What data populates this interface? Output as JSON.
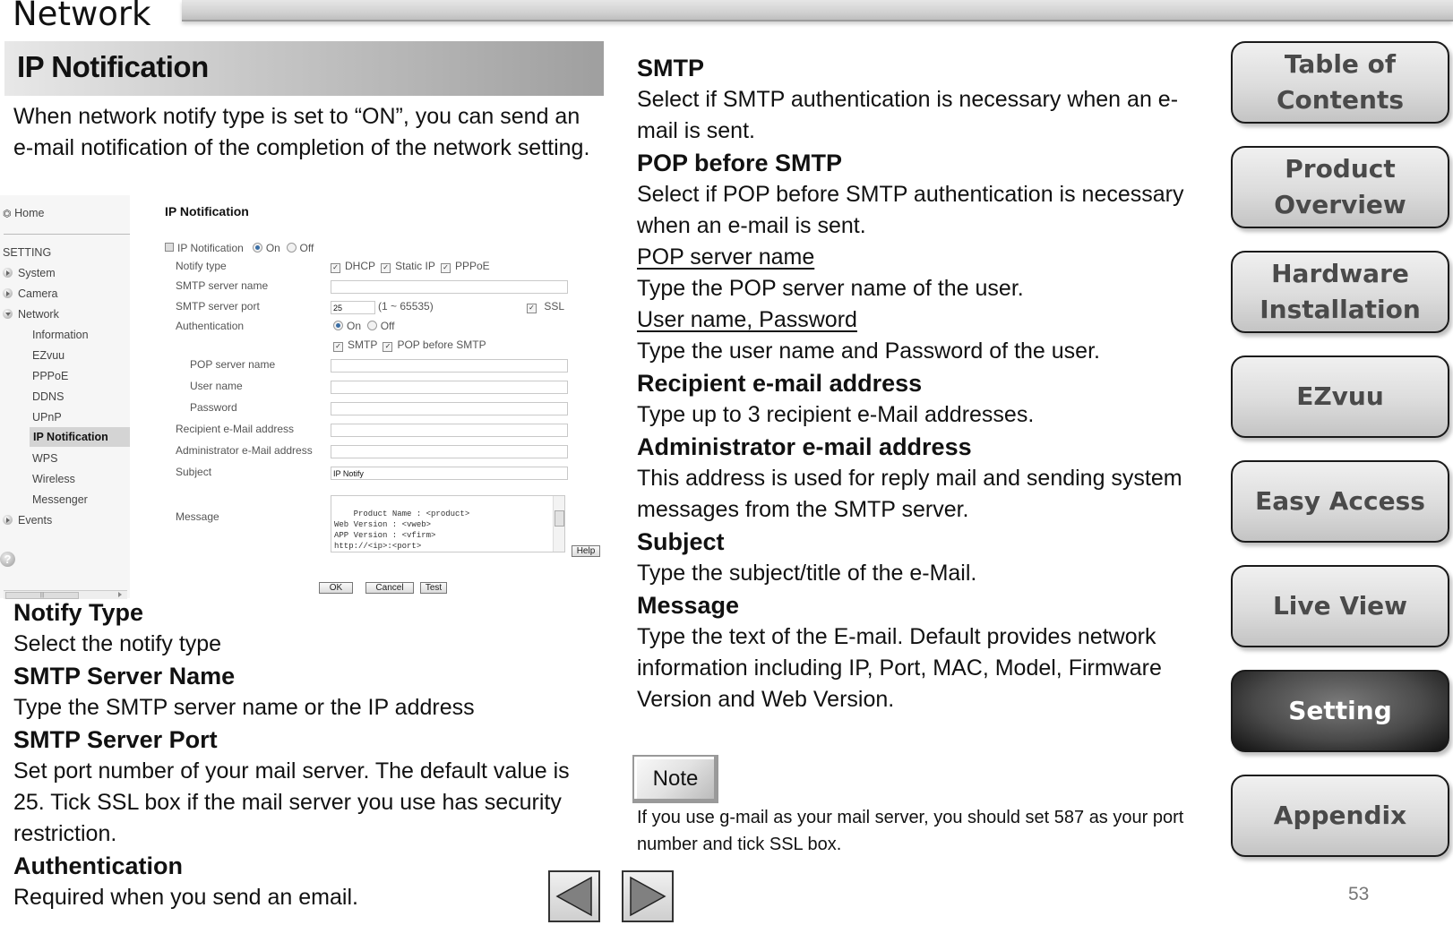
{
  "header": {
    "title": "Network"
  },
  "section": {
    "title": "IP Notification",
    "intro": "When network notify type is set to “ON”, you can send an e-mail notification of the completion of the network setting."
  },
  "screenshot": {
    "sidebar": {
      "home": "Home",
      "setting_header": "SETTING",
      "groups": [
        "System",
        "Camera",
        "Network"
      ],
      "network_items": [
        "Information",
        "EZvuu",
        "PPPoE",
        "DDNS",
        "UPnP",
        "IP Notification",
        "WPS",
        "Wireless",
        "Messenger"
      ],
      "active_item": "IP Notification",
      "events": "Events",
      "help_icon": "?"
    },
    "form": {
      "title": "IP Notification",
      "ip_notification_label": "IP Notification",
      "ip_notification_on": "On",
      "ip_notification_off": "Off",
      "notify_type_label": "Notify type",
      "notify_types": [
        "DHCP",
        "Static IP",
        "PPPoE"
      ],
      "smtp_server_name_label": "SMTP server name",
      "smtp_server_name_value": "",
      "smtp_server_port_label": "SMTP server port",
      "smtp_server_port_value": "25",
      "port_range": "(1 ~ 65535)",
      "ssl_label": "SSL",
      "authentication_label": "Authentication",
      "auth_on": "On",
      "auth_off": "Off",
      "auth_smtp": "SMTP",
      "auth_pop_before_smtp": "POP before SMTP",
      "pop_server_name_label": "POP server name",
      "user_name_label": "User name",
      "password_label": "Password",
      "recipient_label": "Recipient e-Mail address",
      "administrator_label": "Administrator e-Mail address",
      "subject_label": "Subject",
      "subject_value": "IP Notify",
      "message_label": "Message",
      "message_value": "Product Name : <product>\nWeb Version : <vweb>\nAPP Version : <vfirm>\nhttp://<ip>:<port>\nMAC Address : <mac>",
      "help_button": "Help",
      "ok_button": "OK",
      "cancel_button": "Cancel",
      "test_button": "Test"
    }
  },
  "left_descriptions": [
    {
      "heading": "Notify Type",
      "text": "Select the notify type"
    },
    {
      "heading": "SMTP Server Name",
      "text": "Type the SMTP server name or the IP address"
    },
    {
      "heading": "SMTP Server Port",
      "text": "Set port number of your mail server. The default value is 25. Tick SSL box if the mail server you use has security restriction."
    },
    {
      "heading": "Authentication",
      "text": "Required when you send an email."
    }
  ],
  "right_descriptions": {
    "smtp_heading": "SMTP",
    "smtp_text": "Select if SMTP authentication is necessary when an e-mail is sent.",
    "pop_heading": "POP before SMTP",
    "pop_text": "Select if POP before SMTP authentication is necessary when an e-mail is sent.",
    "pop_server_sub": "POP server name",
    "pop_server_text": "Type the POP server name of the user.",
    "user_pass_sub": "User name, Password",
    "user_pass_text": "Type the user name and Password of the user.",
    "recipient_heading": "Recipient e-mail address",
    "recipient_text": "Type up to 3 recipient e-Mail addresses.",
    "admin_heading": "Administrator e-mail address",
    "admin_text": "This address is used for reply mail and sending system messages from the SMTP server.",
    "subject_heading": "Subject",
    "subject_text": "Type the subject/title of the e-Mail.",
    "message_heading": "Message",
    "message_text": "Type the text of the E-mail. Default  provides network information including IP, Port, MAC, Model, Firmware Version and Web Version."
  },
  "note": {
    "label": "Note",
    "text": "If you use g-mail as your mail server, you should set 587 as your port number and tick SSL box."
  },
  "nav": [
    {
      "label": "Table of Contents",
      "active": false
    },
    {
      "label": "Product Overview",
      "active": false
    },
    {
      "label": "Hardware Installation",
      "active": false
    },
    {
      "label": "EZvuu",
      "active": false
    },
    {
      "label": "Easy Access",
      "active": false
    },
    {
      "label": "Live View",
      "active": false
    },
    {
      "label": "Setting",
      "active": true
    },
    {
      "label": "Appendix",
      "active": false
    }
  ],
  "pager": {
    "prev_icon": "previous-page",
    "next_icon": "next-page"
  },
  "page_number": "53"
}
